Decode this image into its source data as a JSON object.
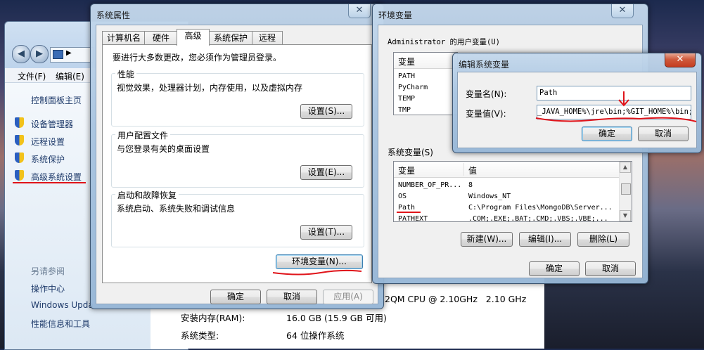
{
  "explorer": {
    "sidebar_top": [
      {
        "label": "控制面板主页",
        "icon": "none"
      },
      {
        "label": "设备管理器",
        "icon": "shield-icon"
      },
      {
        "label": "远程设置",
        "icon": "shield-icon"
      },
      {
        "label": "系统保护",
        "icon": "shield-icon"
      },
      {
        "label": "高级系统设置",
        "icon": "shield-icon"
      }
    ],
    "see_also_heading": "另请参阅",
    "see_also": [
      "操作中心",
      "Windows Upda",
      "性能信息和工具"
    ],
    "menu": [
      "文件(F)",
      "编辑(E)"
    ],
    "info_rows": [
      {
        "label": "",
        "value": "2QM CPU @ 2.10GHz   2.10 GHz"
      },
      {
        "label": "安装内存(RAM):",
        "value": "16.0 GB (15.9 GB 可用)"
      },
      {
        "label": "系统类型:",
        "value": "64 位操作系统"
      }
    ]
  },
  "sysprops": {
    "title": "系统属性",
    "tabs": [
      "计算机名",
      "硬件",
      "高级",
      "系统保护",
      "远程"
    ],
    "active_tab": 2,
    "admin_note": "要进行大多数更改，您必须作为管理员登录。",
    "groups": [
      {
        "label": "性能",
        "desc": "视觉效果，处理器计划，内存使用，以及虚拟内存",
        "button": "设置(S)..."
      },
      {
        "label": "用户配置文件",
        "desc": "与您登录有关的桌面设置",
        "button": "设置(E)..."
      },
      {
        "label": "启动和故障恢复",
        "desc": "系统启动、系统失败和调试信息",
        "button": "设置(T)..."
      }
    ],
    "env_button": "环境变量(N)...",
    "footer": {
      "ok": "确定",
      "cancel": "取消",
      "apply": "应用(A)"
    }
  },
  "envvars": {
    "title": "环境变量",
    "user_section_label": "Administrator 的用户变量(U)",
    "user_header": {
      "var": "变量"
    },
    "user_rows": [
      {
        "var": "PATH"
      },
      {
        "var": "PyCharm"
      },
      {
        "var": "TEMP"
      },
      {
        "var": "TMP"
      }
    ],
    "sys_section_label": "系统变量(S)",
    "sys_header": {
      "var": "变量",
      "val": "值"
    },
    "sys_rows": [
      {
        "var": "NUMBER_OF_PR...",
        "val": "8"
      },
      {
        "var": "OS",
        "val": "Windows_NT"
      },
      {
        "var": "Path",
        "val": "C:\\Program Files\\MongoDB\\Server..."
      },
      {
        "var": "PATHEXT",
        "val": ".COM;.EXE;.BAT;.CMD;.VBS;.VBE;..."
      }
    ],
    "buttons": {
      "new": "新建(W)...",
      "edit": "编辑(I)...",
      "delete": "删除(L)",
      "ok": "确定",
      "cancel": "取消"
    }
  },
  "editvar": {
    "title": "编辑系统变量",
    "name_label": "变量名(N):",
    "name_value": "Path",
    "value_label": "变量值(V):",
    "value_value": "_JAVA_HOME%\\jre\\bin;%GIT_HOME%\\bin;",
    "ok": "确定",
    "cancel": "取消"
  },
  "colors": {
    "annotation": "#e0141a",
    "glass": "#a8c4e0",
    "close": "#c9462a"
  }
}
